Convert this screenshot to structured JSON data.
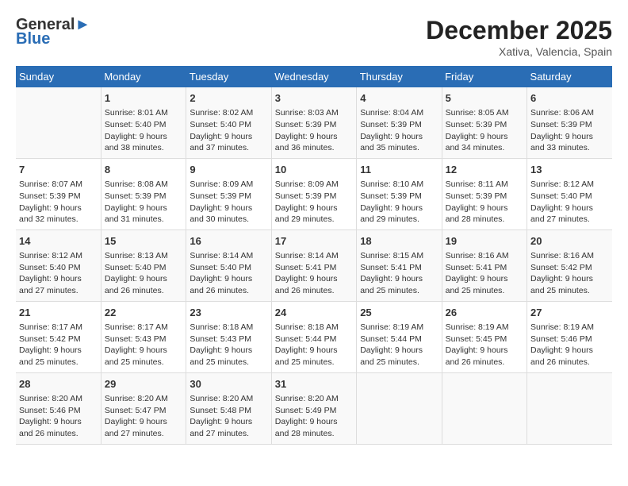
{
  "header": {
    "logo_general": "General",
    "logo_blue": "Blue",
    "month_year": "December 2025",
    "location": "Xativa, Valencia, Spain"
  },
  "weekdays": [
    "Sunday",
    "Monday",
    "Tuesday",
    "Wednesday",
    "Thursday",
    "Friday",
    "Saturday"
  ],
  "weeks": [
    [
      {
        "day": "",
        "sunrise": "",
        "sunset": "",
        "daylight": ""
      },
      {
        "day": "1",
        "sunrise": "Sunrise: 8:01 AM",
        "sunset": "Sunset: 5:40 PM",
        "daylight": "Daylight: 9 hours and 38 minutes."
      },
      {
        "day": "2",
        "sunrise": "Sunrise: 8:02 AM",
        "sunset": "Sunset: 5:40 PM",
        "daylight": "Daylight: 9 hours and 37 minutes."
      },
      {
        "day": "3",
        "sunrise": "Sunrise: 8:03 AM",
        "sunset": "Sunset: 5:39 PM",
        "daylight": "Daylight: 9 hours and 36 minutes."
      },
      {
        "day": "4",
        "sunrise": "Sunrise: 8:04 AM",
        "sunset": "Sunset: 5:39 PM",
        "daylight": "Daylight: 9 hours and 35 minutes."
      },
      {
        "day": "5",
        "sunrise": "Sunrise: 8:05 AM",
        "sunset": "Sunset: 5:39 PM",
        "daylight": "Daylight: 9 hours and 34 minutes."
      },
      {
        "day": "6",
        "sunrise": "Sunrise: 8:06 AM",
        "sunset": "Sunset: 5:39 PM",
        "daylight": "Daylight: 9 hours and 33 minutes."
      }
    ],
    [
      {
        "day": "7",
        "sunrise": "Sunrise: 8:07 AM",
        "sunset": "Sunset: 5:39 PM",
        "daylight": "Daylight: 9 hours and 32 minutes."
      },
      {
        "day": "8",
        "sunrise": "Sunrise: 8:08 AM",
        "sunset": "Sunset: 5:39 PM",
        "daylight": "Daylight: 9 hours and 31 minutes."
      },
      {
        "day": "9",
        "sunrise": "Sunrise: 8:09 AM",
        "sunset": "Sunset: 5:39 PM",
        "daylight": "Daylight: 9 hours and 30 minutes."
      },
      {
        "day": "10",
        "sunrise": "Sunrise: 8:09 AM",
        "sunset": "Sunset: 5:39 PM",
        "daylight": "Daylight: 9 hours and 29 minutes."
      },
      {
        "day": "11",
        "sunrise": "Sunrise: 8:10 AM",
        "sunset": "Sunset: 5:39 PM",
        "daylight": "Daylight: 9 hours and 29 minutes."
      },
      {
        "day": "12",
        "sunrise": "Sunrise: 8:11 AM",
        "sunset": "Sunset: 5:39 PM",
        "daylight": "Daylight: 9 hours and 28 minutes."
      },
      {
        "day": "13",
        "sunrise": "Sunrise: 8:12 AM",
        "sunset": "Sunset: 5:40 PM",
        "daylight": "Daylight: 9 hours and 27 minutes."
      }
    ],
    [
      {
        "day": "14",
        "sunrise": "Sunrise: 8:12 AM",
        "sunset": "Sunset: 5:40 PM",
        "daylight": "Daylight: 9 hours and 27 minutes."
      },
      {
        "day": "15",
        "sunrise": "Sunrise: 8:13 AM",
        "sunset": "Sunset: 5:40 PM",
        "daylight": "Daylight: 9 hours and 26 minutes."
      },
      {
        "day": "16",
        "sunrise": "Sunrise: 8:14 AM",
        "sunset": "Sunset: 5:40 PM",
        "daylight": "Daylight: 9 hours and 26 minutes."
      },
      {
        "day": "17",
        "sunrise": "Sunrise: 8:14 AM",
        "sunset": "Sunset: 5:41 PM",
        "daylight": "Daylight: 9 hours and 26 minutes."
      },
      {
        "day": "18",
        "sunrise": "Sunrise: 8:15 AM",
        "sunset": "Sunset: 5:41 PM",
        "daylight": "Daylight: 9 hours and 25 minutes."
      },
      {
        "day": "19",
        "sunrise": "Sunrise: 8:16 AM",
        "sunset": "Sunset: 5:41 PM",
        "daylight": "Daylight: 9 hours and 25 minutes."
      },
      {
        "day": "20",
        "sunrise": "Sunrise: 8:16 AM",
        "sunset": "Sunset: 5:42 PM",
        "daylight": "Daylight: 9 hours and 25 minutes."
      }
    ],
    [
      {
        "day": "21",
        "sunrise": "Sunrise: 8:17 AM",
        "sunset": "Sunset: 5:42 PM",
        "daylight": "Daylight: 9 hours and 25 minutes."
      },
      {
        "day": "22",
        "sunrise": "Sunrise: 8:17 AM",
        "sunset": "Sunset: 5:43 PM",
        "daylight": "Daylight: 9 hours and 25 minutes."
      },
      {
        "day": "23",
        "sunrise": "Sunrise: 8:18 AM",
        "sunset": "Sunset: 5:43 PM",
        "daylight": "Daylight: 9 hours and 25 minutes."
      },
      {
        "day": "24",
        "sunrise": "Sunrise: 8:18 AM",
        "sunset": "Sunset: 5:44 PM",
        "daylight": "Daylight: 9 hours and 25 minutes."
      },
      {
        "day": "25",
        "sunrise": "Sunrise: 8:19 AM",
        "sunset": "Sunset: 5:44 PM",
        "daylight": "Daylight: 9 hours and 25 minutes."
      },
      {
        "day": "26",
        "sunrise": "Sunrise: 8:19 AM",
        "sunset": "Sunset: 5:45 PM",
        "daylight": "Daylight: 9 hours and 26 minutes."
      },
      {
        "day": "27",
        "sunrise": "Sunrise: 8:19 AM",
        "sunset": "Sunset: 5:46 PM",
        "daylight": "Daylight: 9 hours and 26 minutes."
      }
    ],
    [
      {
        "day": "28",
        "sunrise": "Sunrise: 8:20 AM",
        "sunset": "Sunset: 5:46 PM",
        "daylight": "Daylight: 9 hours and 26 minutes."
      },
      {
        "day": "29",
        "sunrise": "Sunrise: 8:20 AM",
        "sunset": "Sunset: 5:47 PM",
        "daylight": "Daylight: 9 hours and 27 minutes."
      },
      {
        "day": "30",
        "sunrise": "Sunrise: 8:20 AM",
        "sunset": "Sunset: 5:48 PM",
        "daylight": "Daylight: 9 hours and 27 minutes."
      },
      {
        "day": "31",
        "sunrise": "Sunrise: 8:20 AM",
        "sunset": "Sunset: 5:49 PM",
        "daylight": "Daylight: 9 hours and 28 minutes."
      },
      {
        "day": "",
        "sunrise": "",
        "sunset": "",
        "daylight": ""
      },
      {
        "day": "",
        "sunrise": "",
        "sunset": "",
        "daylight": ""
      },
      {
        "day": "",
        "sunrise": "",
        "sunset": "",
        "daylight": ""
      }
    ]
  ]
}
